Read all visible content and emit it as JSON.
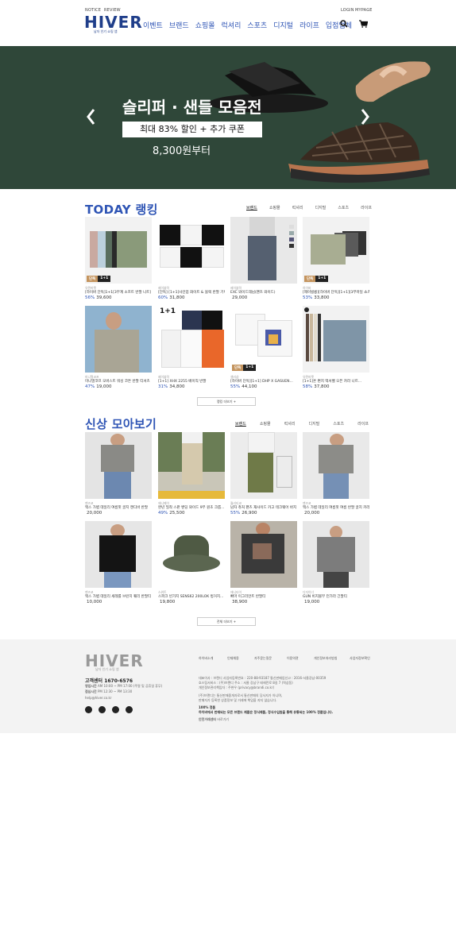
{
  "header": {
    "top_links": [
      "NOTICE",
      "REVIEW"
    ],
    "account_links": [
      "LOGIN",
      "MYPAGE"
    ],
    "logo": "HIVER",
    "logo_sub": "남자 인기 쇼핑 앱",
    "nav": [
      "이벤트",
      "브랜드",
      "쇼핑몰",
      "럭셔리",
      "스포츠",
      "디지털",
      "라이프",
      "입점업체"
    ],
    "icons": [
      "search-icon",
      "cart-icon"
    ]
  },
  "hero": {
    "title": "슬리퍼 · 샌들 모음전",
    "subtitle": "최대 83% 할인 + 추가 쿠폰",
    "price_text": "8,300원부터",
    "bg_color": "#2f4739"
  },
  "ranking": {
    "title": "TODAY 랭킹",
    "tabs": [
      "브랜드",
      "쇼핑몰",
      "럭셔리",
      "디지털",
      "스포츠",
      "라이프"
    ],
    "items": [
      {
        "tag": "유텐마켓",
        "name": "[하이버 단독]1+1[3무계 소프트 반팔 니트]",
        "discount": "56%",
        "price": "39,600",
        "badges": [
          "단독",
          "1+1"
        ]
      },
      {
        "tag": "제이블럭",
        "name": "[단독] [1+1]사인업 화이트 & 블랙 반팔 기획",
        "discount": "60%",
        "price": "31,800",
        "badges": []
      },
      {
        "tag": "제이블럭",
        "name": "EXC 와이드데님(팬츠 와이드)",
        "discount": "",
        "price": "29,000",
        "badges": []
      },
      {
        "tag": "하이버",
        "name": "[제이빌릉][하이버 단독][1+1][3부마일 쇼츠]",
        "discount": "53%",
        "price": "33,800",
        "badges": [
          "단독",
          "1+1"
        ]
      },
      {
        "tag": "미니멀코프",
        "name": "미니멀코프 오버스트 워싱 코튼 반팔 티셔츠",
        "discount": "47%",
        "price": "19,000",
        "badges": []
      },
      {
        "tag": "제이블럭",
        "name": "[1+1] XHX 2255 베이직 반팔",
        "discount": "31%",
        "price": "34,800",
        "badges": []
      },
      {
        "tag": "셀러샵",
        "name": "[하이버 단독][1+1] DHP X GASUEN...",
        "discount": "55%",
        "price": "44,100",
        "badges": [
          "단독",
          "1+1"
        ]
      },
      {
        "tag": "유텐마켓",
        "name": "[1+1]흔 편지 맥셔벨 오픈 카라 니트...",
        "discount": "58%",
        "price": "37,800",
        "badges": []
      }
    ],
    "more_label": "랭킹 더보기 +"
  },
  "newarrivals": {
    "title": "신상 모아보기",
    "tabs": [
      "브랜드",
      "쇼핑몰",
      "럭셔리",
      "디지털",
      "스포츠",
      "라이프"
    ],
    "items": [
      {
        "tag": "맨즈코",
        "name": "맥스 가볍 데일리 여름핏 골지 캔디바 반팔",
        "discount": "",
        "price": "20,000"
      },
      {
        "tag": "애니메이",
        "name": "완년 밀착 스판 밴딩 와이드 9부 원초 크롭...",
        "discount": "49%",
        "price": "25,500"
      },
      {
        "tag": "퀄리티코",
        "name": "남자 츄처 팬츠 재사이드 카고 테크웨어 바지",
        "discount": "55%",
        "price": "26,900"
      },
      {
        "tag": "맨즈코",
        "name": "맥스 가볍 데일리 여름핏 여름 반팔 골지 카라",
        "discount": "",
        "price": "20,000"
      },
      {
        "tag": "맨즈코",
        "name": "맥스 가볍 데일리 세레를 브런치 퀘리 반팔티",
        "discount": "",
        "price": "10,000"
      },
      {
        "tag": "스위트",
        "name": "스파크 빈가지 SENS62 200LOK 벙거지...",
        "discount": "",
        "price": "19,800"
      },
      {
        "tag": "애니타이",
        "name": "빠마 이그리먼트 반팔티",
        "discount": "",
        "price": "38,900"
      },
      {
        "tag": "디자이너",
        "name": "GUN 비지볼부 턴가라 긴팔티",
        "discount": "",
        "price": "19,000"
      }
    ],
    "more_label": "전체 더보기 +"
  },
  "footer": {
    "logo": "HIVER",
    "logo_sub": "남자 인기 쇼핑 앱",
    "links": [
      "하이버소개",
      "인재채용",
      "자주묻는질문",
      "이용약관",
      "개인정보처리방침",
      "사업자정보확인"
    ],
    "cs_label": "고객센터",
    "cs_phone": "1670-6576",
    "hours1_label": "영업시간",
    "hours1": "AM 10:00 ~ PM 17:00 (주말 및 공휴일 휴무)",
    "hours2_label": "점심시간",
    "hours2": "PM 12:30 ~ PM 13:30",
    "email": "help@hiver.co.kr",
    "company_lines": [
      "대표이사 : 브랜디 사업자등록번호 : 220-88-93187 통신판매업신고 : 2016-서울강남-00359",
      "호스팅서비스 : (주)브랜디 주소 : 서울 강남구 테헤란로 8길 7 (역삼동)",
      "개인정보관리책임자 : 주현우 (privacy@brandi.co.kr)"
    ],
    "notice_lines": [
      "(주)브랜디는 통신판매중개자로서 통신판매의 당사자가 아니며,",
      "판매자가 등록한 상품정보 및 거래에 책임을 지지 않습니다."
    ],
    "guarantee_title": "100% 정품",
    "guarantee_text": "하이버에서 판매되는 모든 브랜드 제품은 정식제품, 정식수입원을 통해 유통되는 100% 정품입니다.",
    "safe_label": "안전거래센터",
    "safe_link": "바로가기",
    "sns": [
      "facebook-icon",
      "kakao-icon",
      "instagram-icon",
      "blog-icon"
    ]
  }
}
